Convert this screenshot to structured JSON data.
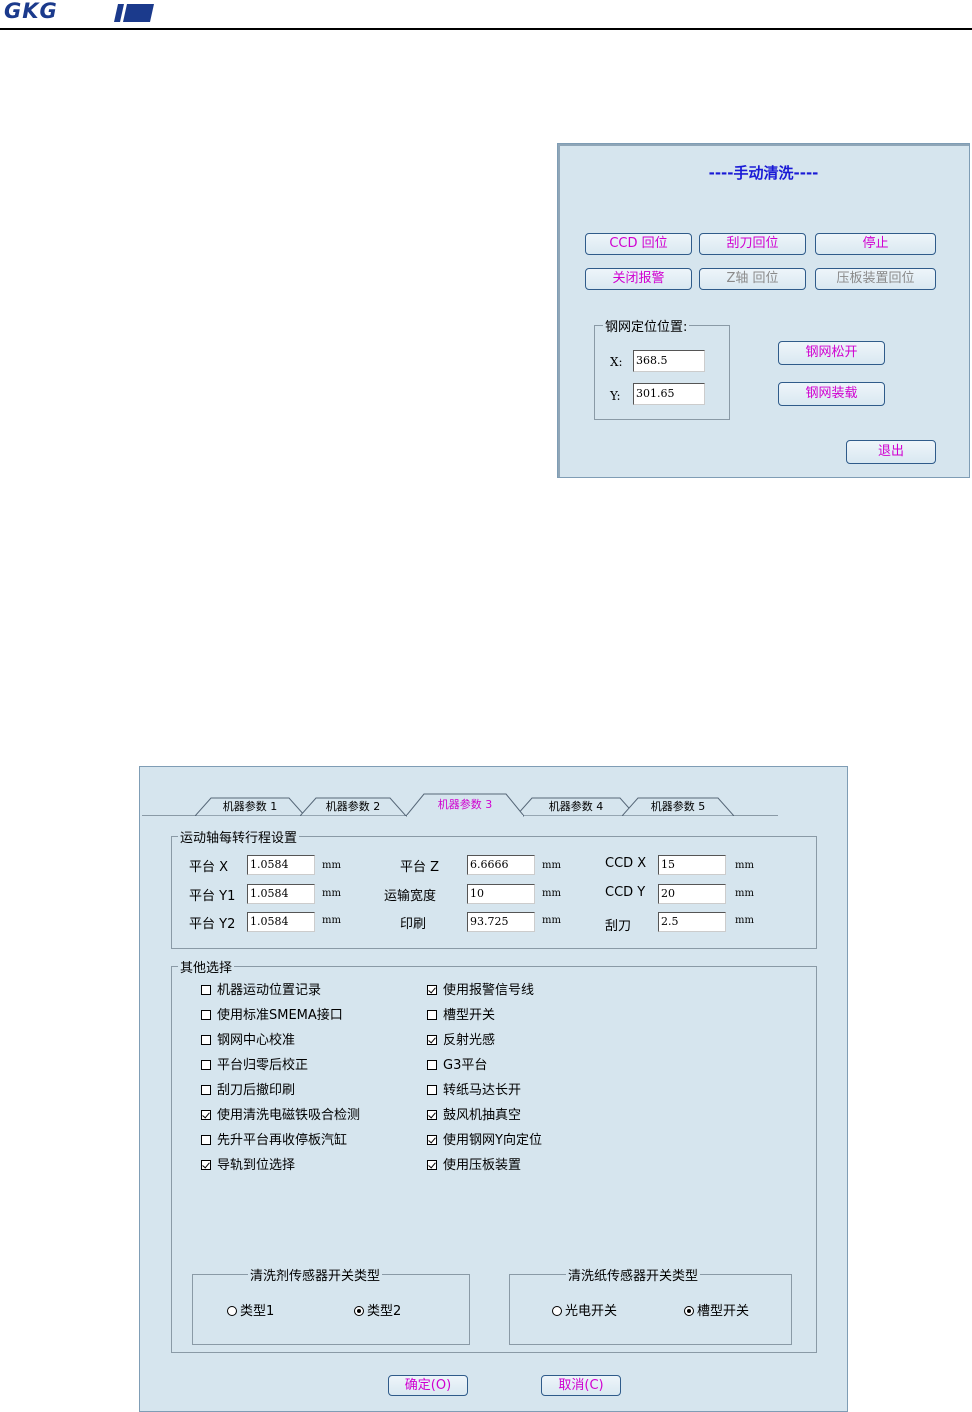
{
  "header": {
    "logo_text": "GKG"
  },
  "manual_clean_dialog": {
    "title": "----手动清洗----",
    "buttons": {
      "ccd_home": "CCD 回位",
      "squeegee_home": "刮刀回位",
      "stop": "停止",
      "close_alarm": "关闭报警",
      "z_axis_home": "Z轴 回位",
      "press_plate_home": "压板装置回位",
      "stencil_release": "钢网松开",
      "stencil_load": "钢网装载",
      "exit": "退出"
    },
    "stencil_position": {
      "legend": "钢网定位位置:",
      "x_label": "X:",
      "x_value": "368.5",
      "y_label": "Y:",
      "y_value": "301.65"
    }
  },
  "machine_params_dialog": {
    "tabs": [
      "机器参数 1",
      "机器参数 2",
      "机器参数 3",
      "机器参数 4",
      "机器参数 5"
    ],
    "active_tab": "机器参数 3",
    "travel_group": {
      "legend": "运动轴每转行程设置",
      "rows": [
        {
          "l1": "平台 X",
          "v1": "1.0584",
          "u1": "mm",
          "l2": "平台 Z",
          "v2": "6.6666",
          "u2": "mm",
          "l3": "CCD X",
          "v3": "15",
          "u3": "mm"
        },
        {
          "l1": "平台 Y1",
          "v1": "1.0584",
          "u1": "mm",
          "l2": "运输宽度",
          "v2": "10",
          "u2": "mm",
          "l3": "CCD Y",
          "v3": "20",
          "u3": "mm"
        },
        {
          "l1": "平台 Y2",
          "v1": "1.0584",
          "u1": "mm",
          "l2": "印刷",
          "v2": "93.725",
          "u2": "mm",
          "l3": "刮刀",
          "v3": "2.5",
          "u3": "mm"
        }
      ]
    },
    "other_group": {
      "legend": "其他选择",
      "left_options": [
        {
          "label": "机器运动位置记录",
          "checked": false
        },
        {
          "label": "使用标准SMEMA接口",
          "checked": false
        },
        {
          "label": "钢网中心校准",
          "checked": false
        },
        {
          "label": "平台归零后校正",
          "checked": false
        },
        {
          "label": "刮刀后撤印刷",
          "checked": false
        },
        {
          "label": "使用清洗电磁铁吸合检测",
          "checked": true
        },
        {
          "label": "先升平台再收停板汽缸",
          "checked": false
        },
        {
          "label": "导轨到位选择",
          "checked": true
        }
      ],
      "right_options": [
        {
          "label": "使用报警信号线",
          "checked": true
        },
        {
          "label": "槽型开关",
          "checked": false
        },
        {
          "label": "反射光感",
          "checked": true
        },
        {
          "label": "G3平台",
          "checked": false
        },
        {
          "label": "转纸马达长开",
          "checked": false
        },
        {
          "label": "鼓风机抽真空",
          "checked": true
        },
        {
          "label": "使用钢网Y向定位",
          "checked": true
        },
        {
          "label": "使用压板装置",
          "checked": true
        }
      ]
    },
    "cleaner_sensor": {
      "legend": "清洗剂传感器开关类型",
      "option1": "类型1",
      "option2": "类型2",
      "selected": "option2"
    },
    "paper_sensor": {
      "legend": "清洗纸传感器开关类型",
      "option1": "光电开关",
      "option2": "槽型开关",
      "selected": "option2"
    },
    "ok_label": "确定(O)",
    "cancel_label": "取消(C)"
  }
}
